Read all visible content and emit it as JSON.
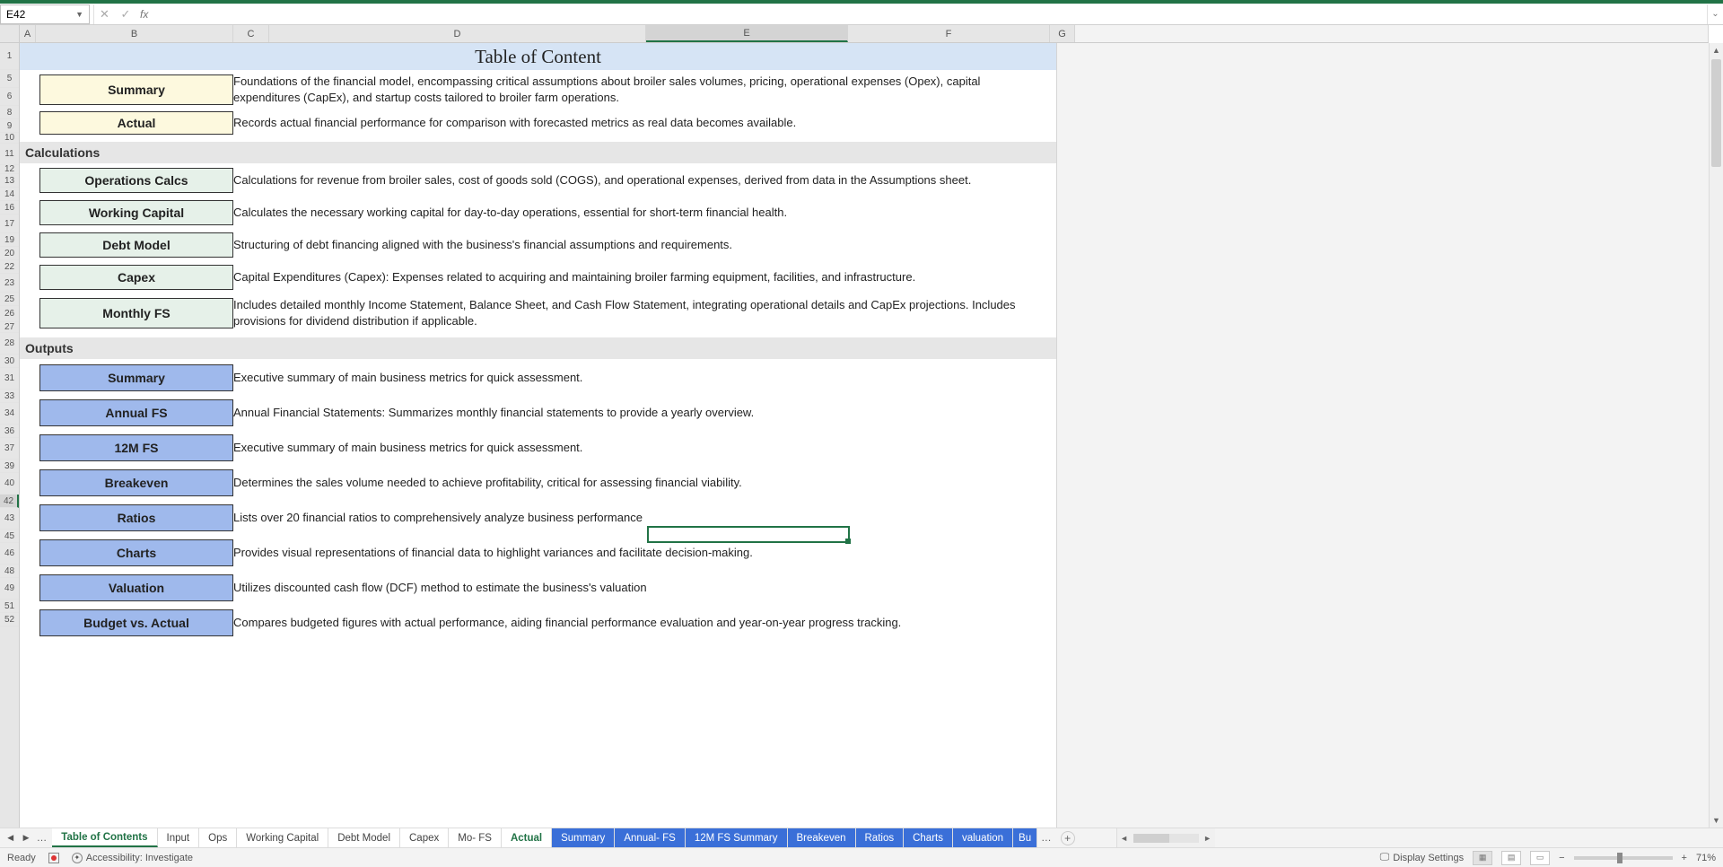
{
  "name_box": "E42",
  "formula": "",
  "title": "Table of Content",
  "col_letters": [
    "A",
    "B",
    "C",
    "D",
    "E",
    "F",
    "G"
  ],
  "row_headers": [
    "1",
    "5",
    "6",
    "8",
    "9",
    "10",
    "11",
    "12",
    "13",
    "14",
    "16",
    "17",
    "19",
    "20",
    "22",
    "23",
    "25",
    "26",
    "27",
    "28",
    "30",
    "31",
    "33",
    "34",
    "36",
    "37",
    "39",
    "40",
    "42",
    "43",
    "45",
    "46",
    "48",
    "49",
    "51",
    "52"
  ],
  "sections": {
    "inputs": [
      {
        "label": "Summary",
        "desc": "Foundations of the financial model, encompassing critical assumptions about broiler sales volumes, pricing, operational expenses (Opex), capital expenditures (CapEx), and startup costs tailored to broiler farm operations."
      },
      {
        "label": "Actual",
        "desc": "Records actual financial performance for comparison with forecasted metrics as real data becomes available."
      }
    ],
    "calc_header": "Calculations",
    "calcs": [
      {
        "label": "Operations Calcs",
        "desc": "Calculations for revenue from broiler sales, cost of goods sold (COGS), and operational expenses, derived from data in the Assumptions sheet."
      },
      {
        "label": "Working Capital",
        "desc": "Calculates the necessary working capital for day-to-day operations, essential for short-term financial health."
      },
      {
        "label": "Debt Model",
        "desc": "Structuring of debt financing aligned with the business's financial assumptions and requirements."
      },
      {
        "label": "Capex",
        "desc": "Capital Expenditures (Capex): Expenses related to acquiring and maintaining broiler farming equipment, facilities, and infrastructure."
      },
      {
        "label": "Monthly FS",
        "desc": "Includes detailed monthly Income Statement, Balance Sheet, and Cash Flow Statement, integrating operational details and CapEx projections. Includes provisions for dividend distribution if applicable."
      }
    ],
    "out_header": "Outputs",
    "outputs": [
      {
        "label": "Summary",
        "desc": "Executive summary of main business metrics for quick assessment."
      },
      {
        "label": "Annual FS",
        "desc": "Annual Financial Statements: Summarizes monthly financial statements to provide a yearly overview."
      },
      {
        "label": "12M FS",
        "desc": "Executive summary of main business metrics for quick assessment."
      },
      {
        "label": "Breakeven",
        "desc": "Determines the sales volume needed to achieve profitability, critical for assessing financial viability."
      },
      {
        "label": "Ratios",
        "desc": "Lists over 20 financial ratios to comprehensively analyze business performance"
      },
      {
        "label": "Charts",
        "desc": "Provides visual representations of financial data to highlight variances and facilitate decision-making."
      },
      {
        "label": "Valuation",
        "desc": "Utilizes discounted cash flow (DCF) method to estimate the business's valuation"
      },
      {
        "label": "Budget vs. Actual",
        "desc": "Compares budgeted figures with actual performance, aiding financial performance evaluation and year-on-year progress tracking."
      }
    ]
  },
  "tabs": {
    "nav_ellipsis": "…",
    "list": [
      {
        "label": "Table of Contents",
        "cls": "active"
      },
      {
        "label": "Input",
        "cls": ""
      },
      {
        "label": "Ops",
        "cls": ""
      },
      {
        "label": "Working Capital",
        "cls": ""
      },
      {
        "label": "Debt Model",
        "cls": ""
      },
      {
        "label": "Capex",
        "cls": ""
      },
      {
        "label": "Mo- FS",
        "cls": ""
      },
      {
        "label": "Actual",
        "cls": "current"
      },
      {
        "label": "Summary",
        "cls": "blue"
      },
      {
        "label": "Annual- FS",
        "cls": "blue"
      },
      {
        "label": "12M FS Summary",
        "cls": "blue"
      },
      {
        "label": "Breakeven",
        "cls": "blue"
      },
      {
        "label": "Ratios",
        "cls": "blue"
      },
      {
        "label": "Charts",
        "cls": "blue"
      },
      {
        "label": "valuation",
        "cls": "blue"
      },
      {
        "label": "Bu",
        "cls": "more"
      }
    ],
    "overflow": "…"
  },
  "status": {
    "ready": "Ready",
    "accessibility": "Accessibility: Investigate",
    "display": "Display Settings",
    "zoom": "71%"
  }
}
